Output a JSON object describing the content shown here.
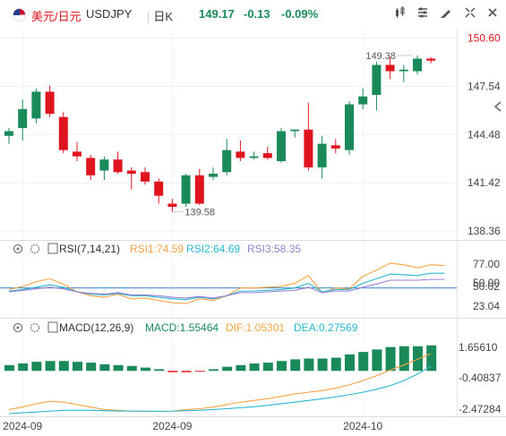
{
  "header": {
    "symbol_cn": "美元/日元",
    "ticker": "USDJPY",
    "timeframe": "日K",
    "last": "149.17",
    "change": "-0.13",
    "change_pct": "-0.09%",
    "icons": [
      "chart-type-icon",
      "indicator-icon",
      "draw-icon",
      "settings-icon",
      "fullscreen-icon",
      "close-icon"
    ]
  },
  "colors": {
    "up": "#1a8a5a",
    "down": "#e0141e",
    "rsi1": "#f5a344",
    "rsi2": "#29b6d0",
    "rsi3": "#9a7fd1",
    "dif": "#f5a344",
    "dea": "#29b6d0"
  },
  "chart_data": [
    {
      "type": "candlestick",
      "title": "",
      "y_ticks": [
        "150.60",
        "147.54",
        "144.48",
        "141.42",
        "138.36"
      ],
      "ylim": [
        137.8,
        151.2
      ],
      "annotations": {
        "high_label": "149.38",
        "low_label": "139.58"
      },
      "candles": [
        {
          "o": 144.4,
          "h": 144.9,
          "l": 143.9,
          "c": 144.7
        },
        {
          "o": 144.9,
          "h": 146.7,
          "l": 144.1,
          "c": 146.1
        },
        {
          "o": 145.5,
          "h": 147.4,
          "l": 145.2,
          "c": 147.2
        },
        {
          "o": 147.2,
          "h": 147.6,
          "l": 145.6,
          "c": 145.8
        },
        {
          "o": 145.6,
          "h": 145.9,
          "l": 143.3,
          "c": 143.5
        },
        {
          "o": 143.4,
          "h": 144.0,
          "l": 142.8,
          "c": 143.1
        },
        {
          "o": 143.0,
          "h": 143.2,
          "l": 141.6,
          "c": 141.9
        },
        {
          "o": 142.2,
          "h": 143.1,
          "l": 141.6,
          "c": 142.9
        },
        {
          "o": 142.9,
          "h": 143.4,
          "l": 142.0,
          "c": 142.1
        },
        {
          "o": 142.2,
          "h": 142.4,
          "l": 141.0,
          "c": 142.0
        },
        {
          "o": 142.1,
          "h": 142.4,
          "l": 141.3,
          "c": 141.5
        },
        {
          "o": 141.5,
          "h": 141.7,
          "l": 140.1,
          "c": 140.6
        },
        {
          "o": 140.1,
          "h": 140.4,
          "l": 139.58,
          "c": 139.9
        },
        {
          "o": 140.1,
          "h": 142.0,
          "l": 139.9,
          "c": 141.9
        },
        {
          "o": 141.9,
          "h": 142.3,
          "l": 140.0,
          "c": 140.1
        },
        {
          "o": 141.8,
          "h": 142.4,
          "l": 141.6,
          "c": 142.0
        },
        {
          "o": 142.1,
          "h": 144.2,
          "l": 141.9,
          "c": 143.5
        },
        {
          "o": 143.4,
          "h": 144.1,
          "l": 142.8,
          "c": 143.0
        },
        {
          "o": 143.0,
          "h": 143.4,
          "l": 142.9,
          "c": 143.1
        },
        {
          "o": 143.3,
          "h": 143.7,
          "l": 142.9,
          "c": 143.0
        },
        {
          "o": 142.8,
          "h": 144.9,
          "l": 142.7,
          "c": 144.7
        },
        {
          "o": 144.7,
          "h": 144.8,
          "l": 144.3,
          "c": 144.8
        },
        {
          "o": 144.8,
          "h": 146.5,
          "l": 142.2,
          "c": 142.4
        },
        {
          "o": 142.4,
          "h": 144.4,
          "l": 141.7,
          "c": 143.9
        },
        {
          "o": 143.8,
          "h": 144.2,
          "l": 143.3,
          "c": 143.6
        },
        {
          "o": 143.5,
          "h": 146.6,
          "l": 143.2,
          "c": 146.4
        },
        {
          "o": 146.4,
          "h": 147.4,
          "l": 146.1,
          "c": 146.9
        },
        {
          "o": 147.0,
          "h": 149.1,
          "l": 146.0,
          "c": 148.9
        },
        {
          "o": 148.9,
          "h": 149.38,
          "l": 148.0,
          "c": 148.5
        },
        {
          "o": 148.5,
          "h": 148.9,
          "l": 147.8,
          "c": 148.6
        },
        {
          "o": 148.5,
          "h": 149.5,
          "l": 148.3,
          "c": 149.3
        },
        {
          "o": 149.3,
          "h": 149.4,
          "l": 149.0,
          "c": 149.17
        }
      ]
    },
    {
      "type": "line",
      "title": "RSI(7,14,21)",
      "y_ticks": [
        "77.00",
        "50.00",
        "50.02",
        "23.04"
      ],
      "ylim": [
        15,
        90
      ],
      "reference_lines": [
        50
      ],
      "legend": [
        {
          "name": "RSI1:74.59",
          "color": "#f5a344"
        },
        {
          "name": "RSI2:64.69",
          "color": "#29b6d0"
        },
        {
          "name": "RSI3:58.35",
          "color": "#9a7fd1"
        }
      ],
      "series": [
        {
          "name": "RSI1",
          "values": [
            48,
            52,
            58,
            62,
            55,
            45,
            40,
            38,
            42,
            36,
            37,
            34,
            31,
            30,
            36,
            34,
            40,
            50,
            50,
            51,
            52,
            56,
            66,
            44,
            50,
            49,
            65,
            73,
            82,
            80,
            76,
            80,
            79
          ]
        },
        {
          "name": "RSI2",
          "values": [
            46,
            48,
            51,
            54,
            51,
            45,
            42,
            41,
            43,
            40,
            40,
            38,
            36,
            35,
            38,
            36,
            40,
            46,
            46,
            47,
            48,
            50,
            56,
            45,
            48,
            48,
            56,
            62,
            68,
            67,
            66,
            69,
            69
          ]
        },
        {
          "name": "RSI3",
          "values": [
            45,
            47,
            49,
            51,
            49,
            45,
            43,
            42,
            44,
            41,
            41,
            40,
            38,
            37,
            39,
            37,
            40,
            44,
            44,
            45,
            46,
            47,
            51,
            44,
            46,
            46,
            51,
            55,
            60,
            60,
            60,
            61,
            61
          ]
        }
      ]
    },
    {
      "type": "bar",
      "title": "MACD(12,26,9)",
      "y_ticks": [
        "1.65610",
        "-0.40837",
        "-2.47284"
      ],
      "ylim": [
        -2.6,
        2.3
      ],
      "legend": [
        {
          "name": "MACD:1.55464",
          "color": "#1a8a5a"
        },
        {
          "name": "DIF:1.05301",
          "color": "#f5a344"
        },
        {
          "name": "DEA:0.27569",
          "color": "#29b6d0"
        }
      ],
      "x_labels": [
        {
          "label": "2024-09",
          "index": 1
        },
        {
          "label": "2024-09",
          "index": 12
        },
        {
          "label": "2024-10",
          "index": 26
        }
      ],
      "histogram": [
        0.35,
        0.45,
        0.55,
        0.6,
        0.6,
        0.55,
        0.5,
        0.4,
        0.35,
        0.3,
        0.2,
        0.1,
        -0.08,
        -0.08,
        -0.05,
        0.1,
        0.25,
        0.35,
        0.45,
        0.5,
        0.6,
        0.7,
        0.75,
        0.75,
        0.8,
        1.0,
        1.15,
        1.3,
        1.45,
        1.5,
        1.5,
        1.55
      ],
      "dif": [
        -2.35,
        -2.2,
        -2.0,
        -1.85,
        -1.9,
        -2.05,
        -2.2,
        -2.35,
        -2.4,
        -2.45,
        -2.45,
        -2.47,
        -2.45,
        -2.35,
        -2.3,
        -2.2,
        -2.05,
        -1.9,
        -1.8,
        -1.7,
        -1.55,
        -1.4,
        -1.3,
        -1.2,
        -1.05,
        -0.85,
        -0.6,
        -0.3,
        0.05,
        0.35,
        0.7,
        1.05
      ],
      "dea": [
        -2.6,
        -2.55,
        -2.5,
        -2.45,
        -2.4,
        -2.4,
        -2.4,
        -2.42,
        -2.44,
        -2.45,
        -2.45,
        -2.46,
        -2.45,
        -2.42,
        -2.4,
        -2.35,
        -2.3,
        -2.24,
        -2.18,
        -2.1,
        -2.0,
        -1.9,
        -1.8,
        -1.7,
        -1.58,
        -1.45,
        -1.3,
        -1.12,
        -0.9,
        -0.6,
        -0.2,
        0.28
      ]
    }
  ]
}
